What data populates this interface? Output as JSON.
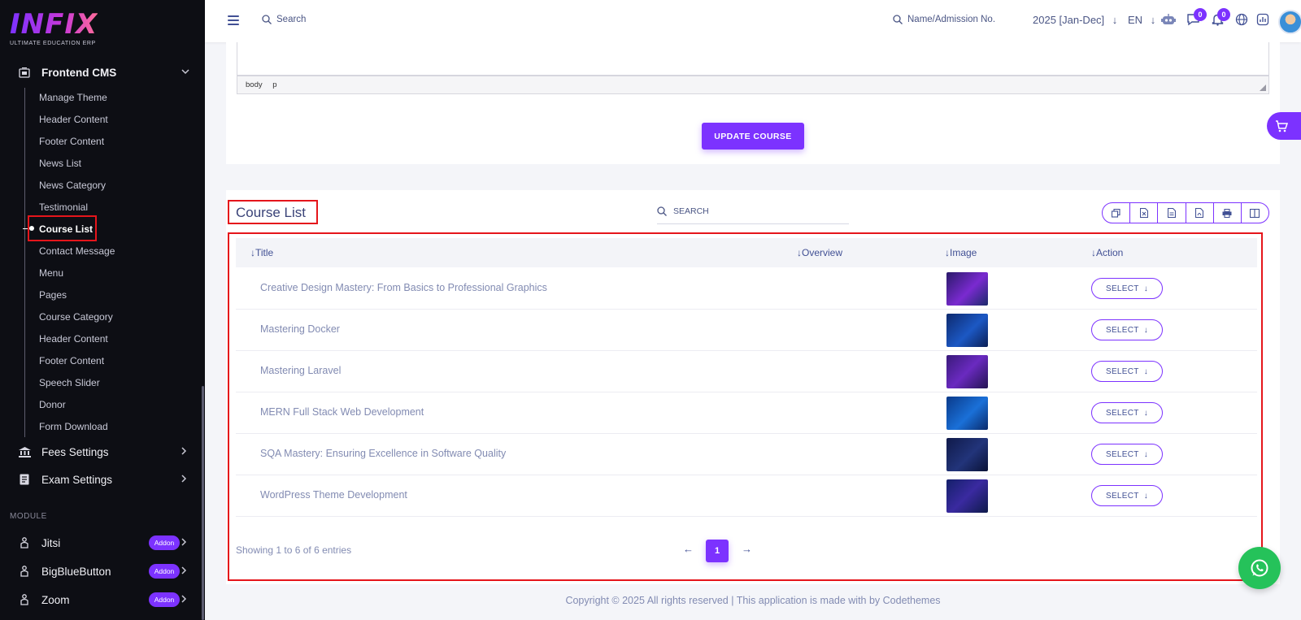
{
  "sidebar": {
    "logo_text": "INFIX",
    "logo_sub": "ULTIMATE EDUCATION ERP",
    "group_label": "Frontend CMS",
    "sub_items": [
      "Manage Theme",
      "Header Content",
      "Footer Content",
      "News List",
      "News Category",
      "Testimonial",
      "Course List",
      "Contact Message",
      "Menu",
      "Pages",
      "Course Category",
      "Header Content",
      "Footer Content",
      "Speech Slider",
      "Donor",
      "Form Download"
    ],
    "active_item": "Course List",
    "fees_label": "Fees Settings",
    "exam_label": "Exam Settings",
    "module_label": "MODULE",
    "modules": [
      {
        "label": "Jitsi",
        "badge": "Addon"
      },
      {
        "label": "BigBlueButton",
        "badge": "Addon"
      },
      {
        "label": "Zoom",
        "badge": "Addon"
      }
    ]
  },
  "topbar": {
    "search_label": "Search",
    "admission_label": "Name/Admission No.",
    "year_label": "2025 [Jan-Dec]",
    "lang_label": "EN",
    "chat_badge": "0",
    "notif_badge": "0"
  },
  "editor": {
    "status_path": [
      "body",
      "p"
    ],
    "update_button": "UPDATE COURSE"
  },
  "course_list": {
    "title": "Course List",
    "search_placeholder": "SEARCH",
    "columns": [
      "Title",
      "Overview",
      "Image",
      "Action"
    ],
    "rows": [
      {
        "title": "Creative Design Mastery: From Basics to Professional Graphics",
        "action": "SELECT"
      },
      {
        "title": "Mastering Docker",
        "action": "SELECT"
      },
      {
        "title": "Mastering Laravel",
        "action": "SELECT"
      },
      {
        "title": "MERN Full Stack Web Development",
        "action": "SELECT"
      },
      {
        "title": "SQA Mastery: Ensuring Excellence in Software Quality",
        "action": "SELECT"
      },
      {
        "title": "WordPress Theme Development",
        "action": "SELECT"
      }
    ],
    "entries_text": "Showing 1 to 6 of 6 entries",
    "current_page": "1"
  },
  "footer": {
    "text": "Copyright © 2025 All rights reserved | This application is made with by Codethemes"
  },
  "colors": {
    "accent": "#7c32ff",
    "sidebar_bg": "#0d0e14",
    "highlight": "#e5151b",
    "whatsapp": "#25c25a"
  }
}
